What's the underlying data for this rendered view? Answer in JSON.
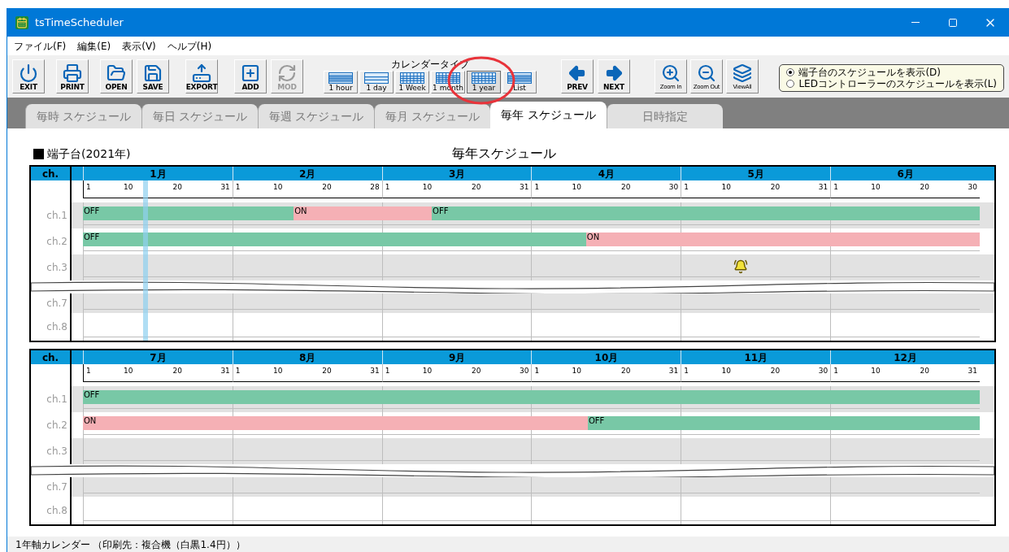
{
  "window": {
    "title": "tsTimeScheduler"
  },
  "menu": [
    "ファイル(F)",
    "編集(E)",
    "表示(V)",
    "ヘルプ(H)"
  ],
  "toolbar": {
    "file_buttons": [
      {
        "label": "EXIT",
        "disabled": false
      },
      {
        "label": "PRINT",
        "disabled": false
      },
      {
        "label": "OPEN",
        "disabled": false
      },
      {
        "label": "SAVE",
        "disabled": false
      },
      {
        "label": "EXPORT",
        "disabled": false
      }
    ],
    "edit_buttons": [
      {
        "label": "ADD",
        "disabled": false
      },
      {
        "label": "MOD",
        "disabled": true
      }
    ],
    "calendar_type": {
      "title": "カレンダータイプ",
      "options": [
        {
          "label": "1 hour",
          "selected": false
        },
        {
          "label": "1 day",
          "selected": false
        },
        {
          "label": "1 Week",
          "selected": false
        },
        {
          "label": "1 month",
          "selected": false
        },
        {
          "label": "1 year",
          "selected": true
        },
        {
          "label": "List",
          "selected": false
        }
      ]
    },
    "nav_buttons": [
      {
        "label": "PREV",
        "disabled": false
      },
      {
        "label": "NEXT",
        "disabled": false
      }
    ],
    "zoom_buttons": [
      {
        "label": "Zoom In",
        "disabled": false
      },
      {
        "label": "Zoom Out",
        "disabled": false
      },
      {
        "label": "ViewAll",
        "disabled": false
      }
    ],
    "display_source": [
      {
        "label": "端子台のスケジュールを表示(D)",
        "selected": true
      },
      {
        "label": "LEDコントローラーのスケジュールを表示(L)",
        "selected": false
      }
    ]
  },
  "tabs": [
    {
      "label": "毎時 スケジュール",
      "selected": false
    },
    {
      "label": "毎日 スケジュール",
      "selected": false
    },
    {
      "label": "毎週 スケジュール",
      "selected": false
    },
    {
      "label": "毎月 スケジュール",
      "selected": false
    },
    {
      "label": "毎年 スケジュール",
      "selected": true
    },
    {
      "label": "日時指定",
      "selected": false
    }
  ],
  "caption": {
    "legend": "端子台(2021年)",
    "title": "毎年スケジュール"
  },
  "calendars": [
    {
      "header": "ch.",
      "today": {
        "level": 0.065
      },
      "months": [
        {
          "name": "1月",
          "ticks": [
            "1",
            "10",
            "20",
            "31"
          ]
        },
        {
          "name": "2月",
          "ticks": [
            "1",
            "10",
            "20",
            "28"
          ]
        },
        {
          "name": "3月",
          "ticks": [
            "1",
            "10",
            "20",
            "31"
          ]
        },
        {
          "name": "4月",
          "ticks": [
            "1",
            "10",
            "20",
            "30"
          ]
        },
        {
          "name": "5月",
          "ticks": [
            "1",
            "10",
            "20",
            "31"
          ]
        },
        {
          "name": "6月",
          "ticks": [
            "1",
            "10",
            "20",
            "30"
          ]
        }
      ],
      "channels": [
        {
          "kind": "channel",
          "label": "ch.1",
          "segments": [
            {
              "label": "OFF",
              "kind": "off"
            },
            {
              "label": "ON",
              "kind": "on"
            },
            {
              "label": "OFF",
              "kind": "off"
            }
          ]
        },
        {
          "kind": "channel",
          "label": "ch.2",
          "segments": [
            {
              "label": "OFF",
              "kind": "off"
            },
            {
              "label": "ON",
              "kind": "on"
            }
          ]
        },
        {
          "kind": "channel",
          "label": "ch.3",
          "alarm": {
            "level": 0.725
          }
        },
        {
          "kind": "break"
        },
        {
          "kind": "channel",
          "label": "ch.7"
        },
        {
          "kind": "channel",
          "label": "ch.8"
        }
      ]
    },
    {
      "header": "ch.",
      "months": [
        {
          "name": "7月",
          "ticks": [
            "1",
            "10",
            "20",
            "31"
          ]
        },
        {
          "name": "8月",
          "ticks": [
            "1",
            "10",
            "20",
            "31"
          ]
        },
        {
          "name": "9月",
          "ticks": [
            "1",
            "10",
            "20",
            "30"
          ]
        },
        {
          "name": "10月",
          "ticks": [
            "1",
            "10",
            "20",
            "31"
          ]
        },
        {
          "name": "11月",
          "ticks": [
            "1",
            "10",
            "20",
            "30"
          ]
        },
        {
          "name": "12月",
          "ticks": [
            "1",
            "10",
            "20",
            "31"
          ]
        }
      ],
      "channels": [
        {
          "kind": "channel",
          "label": "ch.1",
          "segments": [
            {
              "label": "OFF",
              "kind": "off"
            }
          ]
        },
        {
          "kind": "channel",
          "label": "ch.2",
          "segments": [
            {
              "label": "ON",
              "kind": "on"
            },
            {
              "label": "OFF",
              "kind": "off"
            }
          ]
        },
        {
          "kind": "channel",
          "label": "ch.3"
        },
        {
          "kind": "break"
        },
        {
          "kind": "channel",
          "label": "ch.7"
        },
        {
          "kind": "channel",
          "label": "ch.8"
        }
      ]
    }
  ],
  "status_bar": "1年軸カレンダー （印刷先：複合機（白黒1.4円））"
}
